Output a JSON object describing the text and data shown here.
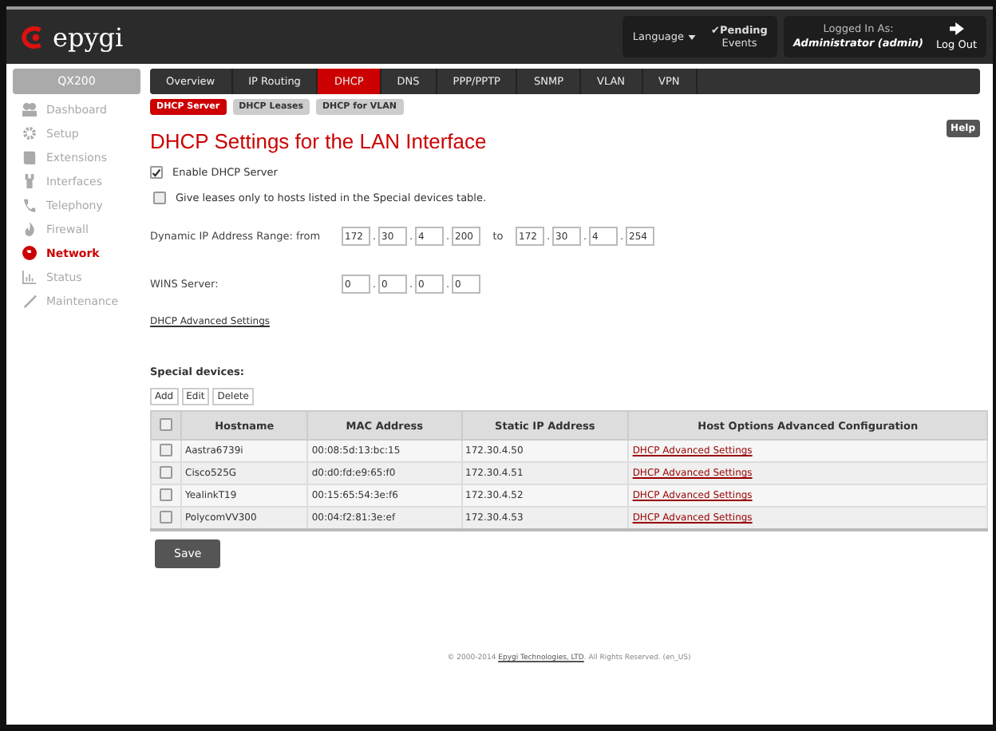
{
  "header": {
    "logo": "epygi",
    "language": "Language",
    "pending": "✔Pending",
    "pending_sub": "Events",
    "logged_label": "Logged In As:",
    "logged_user": "Administrator (admin)",
    "logout": "Log Out"
  },
  "sidebar": {
    "title": "QX200",
    "items": [
      {
        "label": "Dashboard",
        "selected": false
      },
      {
        "label": "Setup",
        "selected": false
      },
      {
        "label": "Extensions",
        "selected": false
      },
      {
        "label": "Interfaces",
        "selected": false
      },
      {
        "label": "Telephony",
        "selected": false
      },
      {
        "label": "Firewall",
        "selected": false
      },
      {
        "label": "Network",
        "selected": true
      },
      {
        "label": "Status",
        "selected": false
      },
      {
        "label": "Maintenance",
        "selected": false
      }
    ]
  },
  "ip_separator": ".",
  "tabs": [
    {
      "label": "Overview",
      "selected": false
    },
    {
      "label": "IP Routing",
      "selected": false
    },
    {
      "label": "DHCP",
      "selected": true
    },
    {
      "label": "DNS",
      "selected": false
    },
    {
      "label": "PPP/PPTP",
      "selected": false
    },
    {
      "label": "SNMP",
      "selected": false
    },
    {
      "label": "VLAN",
      "selected": false
    },
    {
      "label": "VPN",
      "selected": false
    }
  ],
  "subtabs": [
    {
      "label": "DHCP Server",
      "selected": true
    },
    {
      "label": "DHCP Leases",
      "selected": false
    },
    {
      "label": "DHCP for VLAN",
      "selected": false
    }
  ],
  "help": "Help",
  "title": "DHCP Settings for the LAN Interface",
  "options": [
    {
      "label": "Enable DHCP Server",
      "checked": true
    },
    {
      "label": "Give leases only to hosts listed in the Special devices table.",
      "checked": false
    }
  ],
  "range": {
    "label": "Dynamic IP Address Range: from",
    "from": [
      "172",
      "30",
      "4",
      "200"
    ],
    "to_label": "to",
    "to": [
      "172",
      "30",
      "4",
      "254"
    ]
  },
  "wins": {
    "label": "WINS Server:",
    "value": [
      "0",
      "0",
      "0",
      "0"
    ]
  },
  "advanced_link": "DHCP Advanced Settings",
  "special": {
    "title": "Special devices:",
    "buttons": [
      "Add",
      "Edit",
      "Delete"
    ],
    "columns": [
      "Hostname",
      "MAC Address",
      "Static IP Address",
      "Host Options Advanced Configuration"
    ],
    "header_checked": false,
    "rows": [
      {
        "checked": false,
        "cells": [
          "Aastra6739i",
          "00:08:5d:13:bc:15",
          "172.30.4.50"
        ],
        "link": "DHCP Advanced Settings"
      },
      {
        "checked": false,
        "cells": [
          "Cisco525G",
          "d0:d0:fd:e9:65:f0",
          "172.30.4.51"
        ],
        "link": "DHCP Advanced Settings"
      },
      {
        "checked": false,
        "cells": [
          "YealinkT19",
          "00:15:65:54:3e:f6",
          "172.30.4.52"
        ],
        "link": "DHCP Advanced Settings"
      },
      {
        "checked": false,
        "cells": [
          "PolycomVV300",
          "00:04:f2:81:3e:ef",
          "172.30.4.53"
        ],
        "link": "DHCP Advanced Settings"
      }
    ]
  },
  "save": "Save",
  "footer": {
    "prefix": "© 2000-2014 ",
    "link": "Epygi Technologies, LTD",
    "suffix": ". All Rights Reserved. (en_US)"
  }
}
